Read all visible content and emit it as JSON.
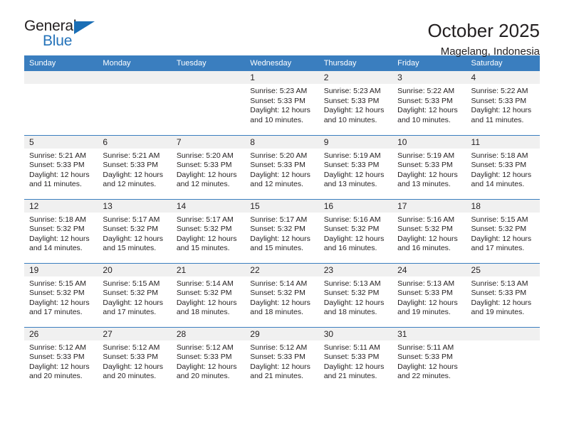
{
  "logo": {
    "line1": "General",
    "line2": "Blue",
    "triangle_color": "#1a6eb5",
    "text_color": "#231f20"
  },
  "header": {
    "title": "October 2025",
    "subtitle": "Magelang, Indonesia"
  },
  "colors": {
    "header_row_bg": "#3a7ebf",
    "header_row_text": "#ffffff",
    "daynum_bg": "#f0f0f0",
    "grid_line": "#3a7ebf",
    "body_text": "#231f20"
  },
  "weekday_headers": [
    "Sunday",
    "Monday",
    "Tuesday",
    "Wednesday",
    "Thursday",
    "Friday",
    "Saturday"
  ],
  "weeks": [
    [
      {
        "day": "",
        "lines": []
      },
      {
        "day": "",
        "lines": []
      },
      {
        "day": "",
        "lines": []
      },
      {
        "day": "1",
        "lines": [
          "Sunrise: 5:23 AM",
          "Sunset: 5:33 PM",
          "Daylight: 12 hours",
          "and 10 minutes."
        ]
      },
      {
        "day": "2",
        "lines": [
          "Sunrise: 5:23 AM",
          "Sunset: 5:33 PM",
          "Daylight: 12 hours",
          "and 10 minutes."
        ]
      },
      {
        "day": "3",
        "lines": [
          "Sunrise: 5:22 AM",
          "Sunset: 5:33 PM",
          "Daylight: 12 hours",
          "and 10 minutes."
        ]
      },
      {
        "day": "4",
        "lines": [
          "Sunrise: 5:22 AM",
          "Sunset: 5:33 PM",
          "Daylight: 12 hours",
          "and 11 minutes."
        ]
      }
    ],
    [
      {
        "day": "5",
        "lines": [
          "Sunrise: 5:21 AM",
          "Sunset: 5:33 PM",
          "Daylight: 12 hours",
          "and 11 minutes."
        ]
      },
      {
        "day": "6",
        "lines": [
          "Sunrise: 5:21 AM",
          "Sunset: 5:33 PM",
          "Daylight: 12 hours",
          "and 12 minutes."
        ]
      },
      {
        "day": "7",
        "lines": [
          "Sunrise: 5:20 AM",
          "Sunset: 5:33 PM",
          "Daylight: 12 hours",
          "and 12 minutes."
        ]
      },
      {
        "day": "8",
        "lines": [
          "Sunrise: 5:20 AM",
          "Sunset: 5:33 PM",
          "Daylight: 12 hours",
          "and 12 minutes."
        ]
      },
      {
        "day": "9",
        "lines": [
          "Sunrise: 5:19 AM",
          "Sunset: 5:33 PM",
          "Daylight: 12 hours",
          "and 13 minutes."
        ]
      },
      {
        "day": "10",
        "lines": [
          "Sunrise: 5:19 AM",
          "Sunset: 5:33 PM",
          "Daylight: 12 hours",
          "and 13 minutes."
        ]
      },
      {
        "day": "11",
        "lines": [
          "Sunrise: 5:18 AM",
          "Sunset: 5:33 PM",
          "Daylight: 12 hours",
          "and 14 minutes."
        ]
      }
    ],
    [
      {
        "day": "12",
        "lines": [
          "Sunrise: 5:18 AM",
          "Sunset: 5:32 PM",
          "Daylight: 12 hours",
          "and 14 minutes."
        ]
      },
      {
        "day": "13",
        "lines": [
          "Sunrise: 5:17 AM",
          "Sunset: 5:32 PM",
          "Daylight: 12 hours",
          "and 15 minutes."
        ]
      },
      {
        "day": "14",
        "lines": [
          "Sunrise: 5:17 AM",
          "Sunset: 5:32 PM",
          "Daylight: 12 hours",
          "and 15 minutes."
        ]
      },
      {
        "day": "15",
        "lines": [
          "Sunrise: 5:17 AM",
          "Sunset: 5:32 PM",
          "Daylight: 12 hours",
          "and 15 minutes."
        ]
      },
      {
        "day": "16",
        "lines": [
          "Sunrise: 5:16 AM",
          "Sunset: 5:32 PM",
          "Daylight: 12 hours",
          "and 16 minutes."
        ]
      },
      {
        "day": "17",
        "lines": [
          "Sunrise: 5:16 AM",
          "Sunset: 5:32 PM",
          "Daylight: 12 hours",
          "and 16 minutes."
        ]
      },
      {
        "day": "18",
        "lines": [
          "Sunrise: 5:15 AM",
          "Sunset: 5:32 PM",
          "Daylight: 12 hours",
          "and 17 minutes."
        ]
      }
    ],
    [
      {
        "day": "19",
        "lines": [
          "Sunrise: 5:15 AM",
          "Sunset: 5:32 PM",
          "Daylight: 12 hours",
          "and 17 minutes."
        ]
      },
      {
        "day": "20",
        "lines": [
          "Sunrise: 5:15 AM",
          "Sunset: 5:32 PM",
          "Daylight: 12 hours",
          "and 17 minutes."
        ]
      },
      {
        "day": "21",
        "lines": [
          "Sunrise: 5:14 AM",
          "Sunset: 5:32 PM",
          "Daylight: 12 hours",
          "and 18 minutes."
        ]
      },
      {
        "day": "22",
        "lines": [
          "Sunrise: 5:14 AM",
          "Sunset: 5:32 PM",
          "Daylight: 12 hours",
          "and 18 minutes."
        ]
      },
      {
        "day": "23",
        "lines": [
          "Sunrise: 5:13 AM",
          "Sunset: 5:32 PM",
          "Daylight: 12 hours",
          "and 18 minutes."
        ]
      },
      {
        "day": "24",
        "lines": [
          "Sunrise: 5:13 AM",
          "Sunset: 5:33 PM",
          "Daylight: 12 hours",
          "and 19 minutes."
        ]
      },
      {
        "day": "25",
        "lines": [
          "Sunrise: 5:13 AM",
          "Sunset: 5:33 PM",
          "Daylight: 12 hours",
          "and 19 minutes."
        ]
      }
    ],
    [
      {
        "day": "26",
        "lines": [
          "Sunrise: 5:12 AM",
          "Sunset: 5:33 PM",
          "Daylight: 12 hours",
          "and 20 minutes."
        ]
      },
      {
        "day": "27",
        "lines": [
          "Sunrise: 5:12 AM",
          "Sunset: 5:33 PM",
          "Daylight: 12 hours",
          "and 20 minutes."
        ]
      },
      {
        "day": "28",
        "lines": [
          "Sunrise: 5:12 AM",
          "Sunset: 5:33 PM",
          "Daylight: 12 hours",
          "and 20 minutes."
        ]
      },
      {
        "day": "29",
        "lines": [
          "Sunrise: 5:12 AM",
          "Sunset: 5:33 PM",
          "Daylight: 12 hours",
          "and 21 minutes."
        ]
      },
      {
        "day": "30",
        "lines": [
          "Sunrise: 5:11 AM",
          "Sunset: 5:33 PM",
          "Daylight: 12 hours",
          "and 21 minutes."
        ]
      },
      {
        "day": "31",
        "lines": [
          "Sunrise: 5:11 AM",
          "Sunset: 5:33 PM",
          "Daylight: 12 hours",
          "and 22 minutes."
        ]
      },
      {
        "day": "",
        "lines": []
      }
    ]
  ]
}
